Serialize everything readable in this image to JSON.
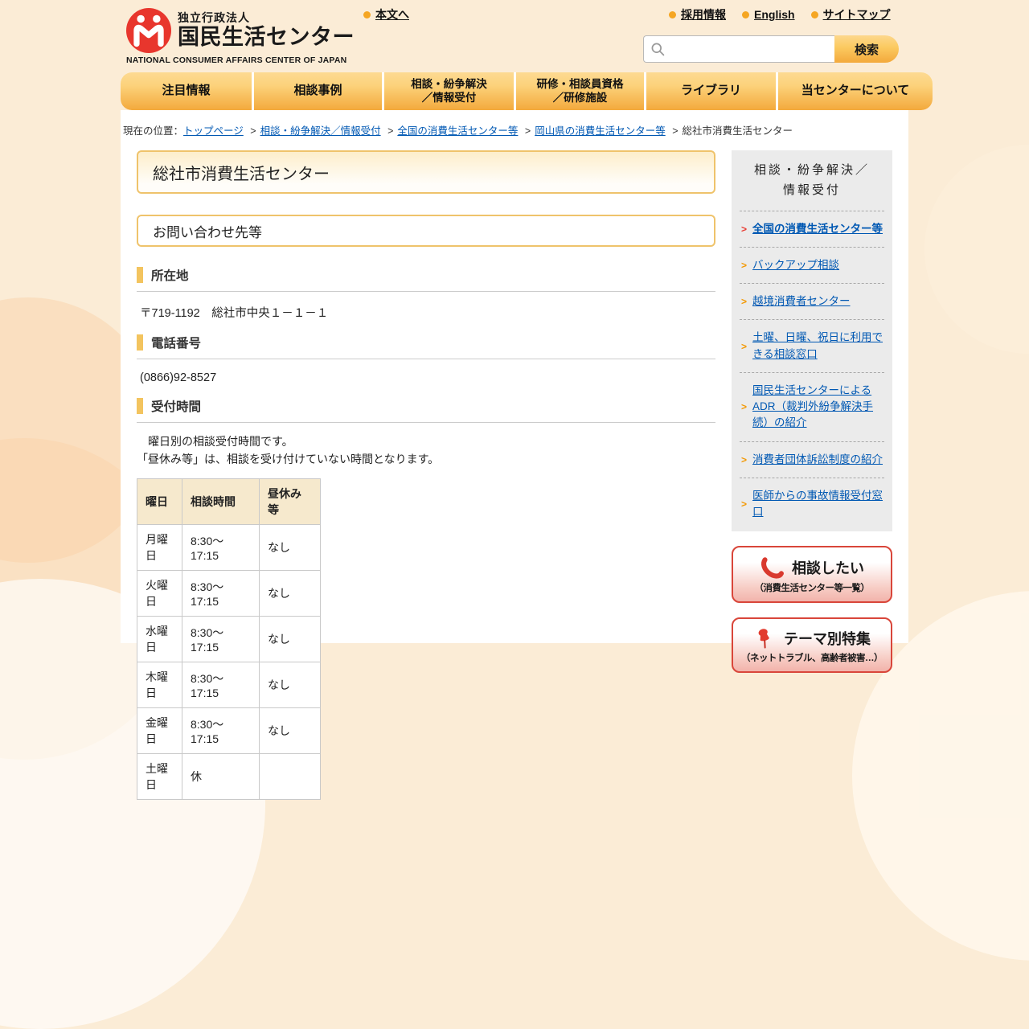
{
  "header": {
    "org_type": "独立行政法人",
    "org_name": "国民生活センター",
    "org_name_en": "NATIONAL CONSUMER AFFAIRS CENTER OF JAPAN",
    "skip_link": "本文へ",
    "links": [
      {
        "label": "採用情報"
      },
      {
        "label": "English"
      },
      {
        "label": "サイトマップ"
      }
    ],
    "search": {
      "value": "",
      "button_label": "検索"
    }
  },
  "nav": {
    "items": [
      "注目情報",
      "相談事例",
      "相談・紛争解決\n／情報受付",
      "研修・相談員資格\n／研修施設",
      "ライブラリ",
      "当センターについて"
    ]
  },
  "breadcrumb": {
    "prefix": "現在の位置：",
    "separator": ">",
    "links": [
      "トップページ",
      "相談・紛争解決／情報受付",
      "全国の消費生活センター等",
      "岡山県の消費生活センター等"
    ],
    "current": "総社市消費生活センター"
  },
  "main": {
    "page_title": "総社市消費生活センター",
    "section_title": "お問い合わせ先等",
    "address": {
      "heading": "所在地",
      "value": "〒719-1192　総社市中央１－１－１"
    },
    "phone": {
      "heading": "電話番号",
      "value": "(0866)92-8527"
    },
    "hours": {
      "heading": "受付時間",
      "note1": "　曜日別の相談受付時間です。",
      "note2": "「昼休み等」は、相談を受け付けていない時間となります。",
      "table": {
        "headers": [
          "曜日",
          "相談時間",
          "昼休み等"
        ],
        "rows": [
          [
            "月曜日",
            "8:30～17:15",
            "なし"
          ],
          [
            "火曜日",
            "8:30～17:15",
            "なし"
          ],
          [
            "水曜日",
            "8:30～17:15",
            "なし"
          ],
          [
            "木曜日",
            "8:30～17:15",
            "なし"
          ],
          [
            "金曜日",
            "8:30～17:15",
            "なし"
          ],
          [
            "土曜日",
            "休",
            ""
          ]
        ]
      }
    }
  },
  "sidebar": {
    "heading": "相談・紛争解決／\n情報受付",
    "arrow_glyph": ">",
    "items": [
      {
        "label": "全国の消費生活センター等"
      },
      {
        "label": "バックアップ相談"
      },
      {
        "label": "越境消費者センター"
      },
      {
        "label": "土曜、日曜、祝日に利用できる相談窓口"
      },
      {
        "label": "国民生活センターによるADR（裁判外紛争解決手続）の紹介"
      },
      {
        "label": "消費者団体訴訟制度の紹介"
      },
      {
        "label": "医師からの事故情報受付窓口"
      }
    ],
    "consult_button": {
      "title": "相談したい",
      "subtitle": "（消費生活センター等一覧）"
    },
    "theme_button": {
      "title": "テーマ別特集",
      "subtitle": "（ネットトラブル、高齢者被害…）"
    }
  },
  "colors": {
    "accent_orange": "#f3a93c",
    "link_blue": "#0058b3",
    "alert_red": "#d9463a",
    "logo_red": "#e8362d"
  }
}
